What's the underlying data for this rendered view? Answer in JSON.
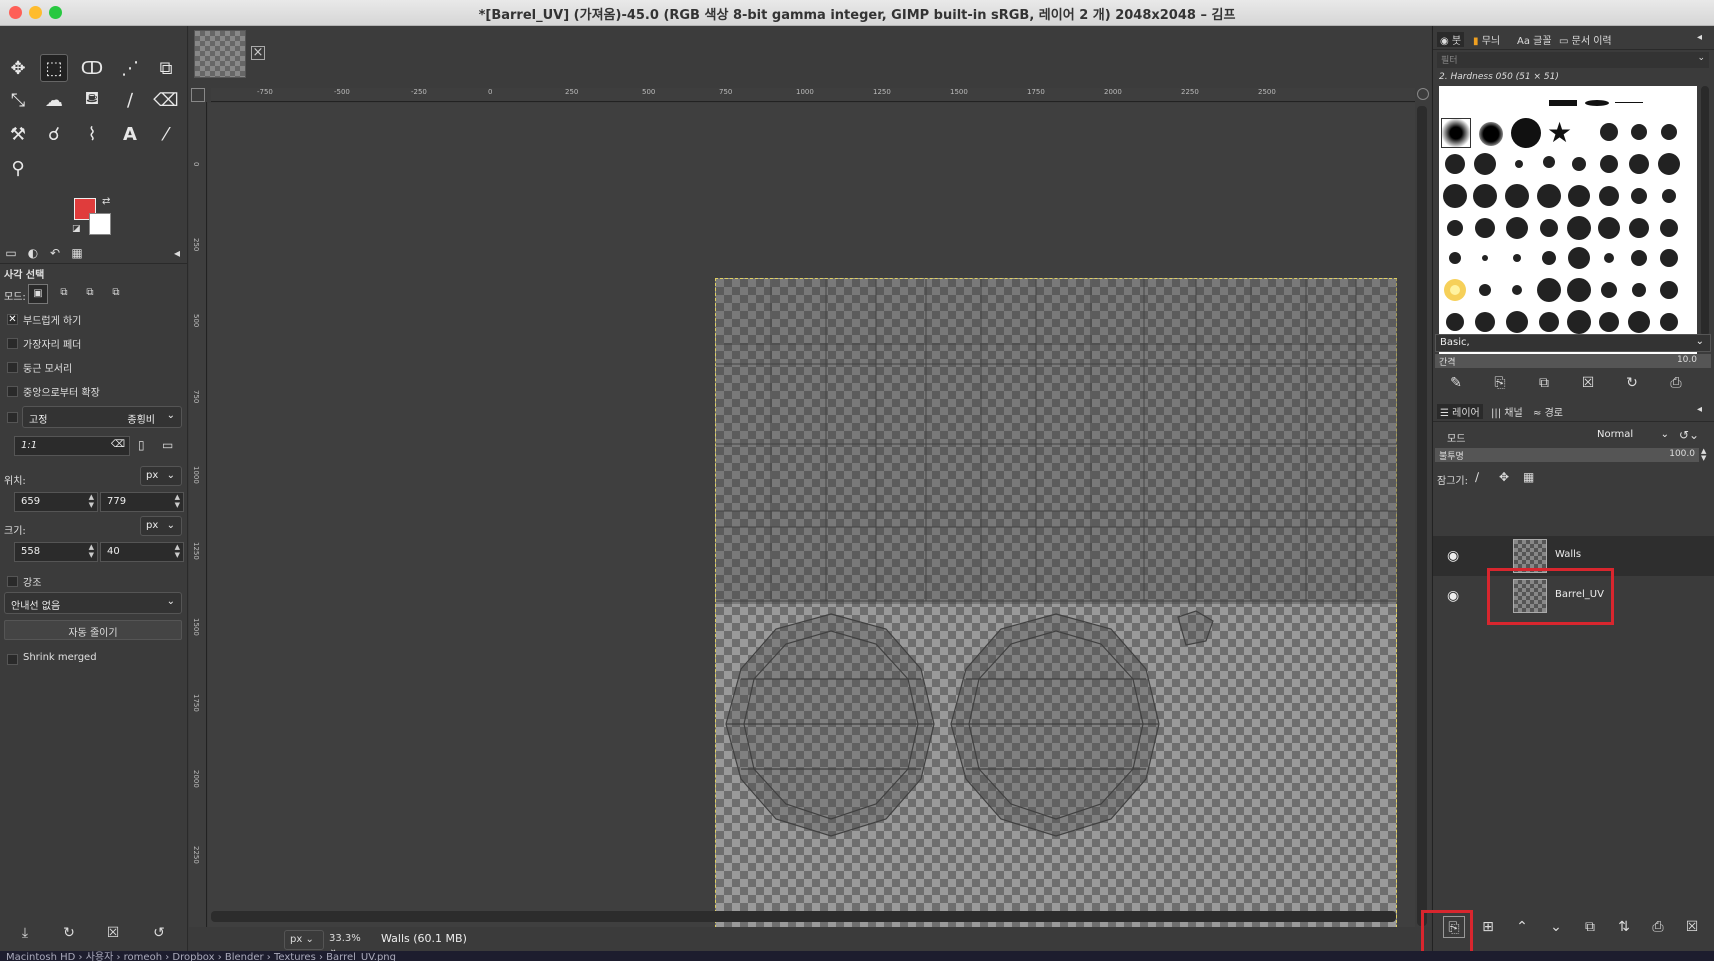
{
  "window": {
    "title": "*[Barrel_UV] (가져옴)-45.0 (RGB 색상 8-bit gamma integer, GIMP built-in sRGB, 레이어 2 개) 2048x2048 – 김프"
  },
  "toolbox": {
    "tools": [
      "move-icon",
      "rect-select-icon",
      "free-select-icon",
      "fuzzy-select-icon",
      "crop-icon",
      "transform-icon",
      "warp-icon",
      "bucket-fill-icon",
      "paintbrush-icon",
      "eraser-icon",
      "clone-icon",
      "smudge-icon",
      "paths-icon",
      "text-icon",
      "color-picker-icon",
      "zoom-icon"
    ],
    "tool_glyphs": [
      "✥",
      "⬚",
      "ↀ",
      "⋰",
      "⧉",
      "⤡",
      "☁",
      "⛾",
      "∕",
      "⌫",
      "⚒",
      "☌",
      "⌇",
      "A",
      "⁄",
      "⚲"
    ]
  },
  "tool_options": {
    "title": "사각 선택",
    "mode_label": "모드:",
    "antialias": "부드럽게 하기",
    "feather": "가장자리 페더",
    "rounded": "둥근 모서리",
    "expand_center": "중앙으로부터 확장",
    "fixed": "고정",
    "fixed_mode": "종횡비",
    "ratio": "1:1",
    "position_label": "위치:",
    "position_unit": "px",
    "pos_x": "659",
    "pos_y": "779",
    "size_label": "크기:",
    "size_unit": "px",
    "size_w": "558",
    "size_h": "40",
    "highlight": "강조",
    "guides": "안내선 없음",
    "auto_shrink": "자동 줄이기",
    "shrink_merged": "Shrink merged"
  },
  "ruler_top_labels": [
    "-750",
    "-500",
    "-250",
    "0",
    "250",
    "500",
    "750",
    "1000",
    "1250",
    "1500",
    "1750",
    "2000",
    "2250",
    "2500"
  ],
  "ruler_left_labels": [
    "0",
    "250",
    "500",
    "750",
    "1000",
    "1250",
    "1500",
    "1750",
    "2000",
    "2250"
  ],
  "statusbar": {
    "unit": "px",
    "zoom": "33.3%",
    "message": "Walls (60.1 MB)"
  },
  "brushes": {
    "tabs": [
      "붓",
      "무늬",
      "글꼴",
      "문서 이력"
    ],
    "filter_placeholder": "필터",
    "current": "2. Hardness 050 (51 × 51)",
    "tag": "Basic,",
    "spacing_label": "간격",
    "spacing_value": "10.0"
  },
  "layers": {
    "tabs": [
      "레이어",
      "채널",
      "경로"
    ],
    "mode_label": "모드",
    "mode_value": "Normal",
    "opacity_label": "불투명",
    "opacity_value": "100.0",
    "lock_label": "잠그기:",
    "items": [
      {
        "name": "Walls"
      },
      {
        "name": "Barrel_UV"
      }
    ]
  },
  "pathbar": "Macintosh HD › 사용자 › romeoh › Dropbox › Blender › Textures › Barrel_UV.png",
  "colors": {
    "foreground": "#e03c3c",
    "background": "#ffffff",
    "highlight": "#d8262e"
  }
}
